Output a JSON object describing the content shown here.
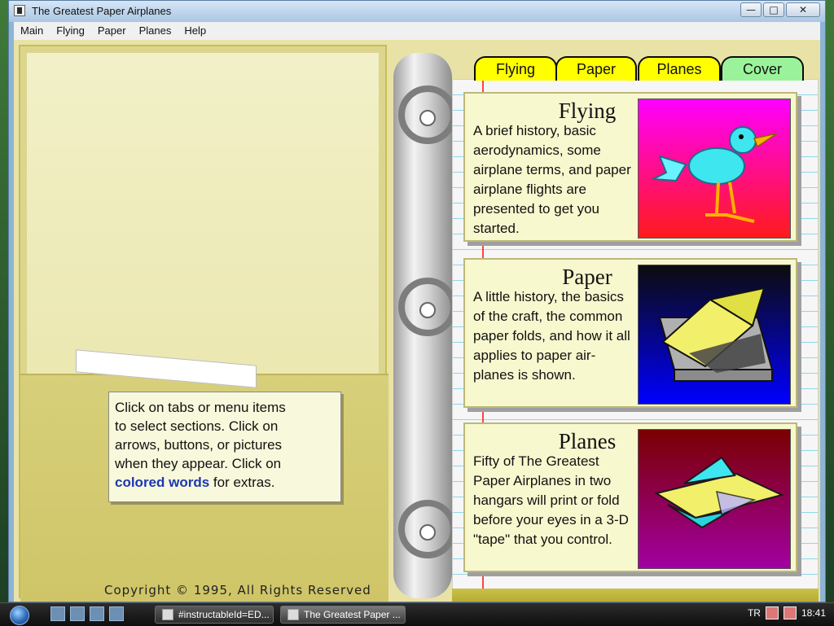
{
  "window": {
    "title": "The Greatest Paper Airplanes",
    "buttons": {
      "minimize": "—",
      "maximize": "□",
      "close": "✕"
    }
  },
  "menu": {
    "items": [
      "Main",
      "Flying",
      "Paper",
      "Planes",
      "Help"
    ]
  },
  "tabs": [
    "Flying",
    "Paper",
    "Planes",
    "Cover"
  ],
  "note": {
    "line1": "Click on tabs or menu items",
    "line2": "to select sections.  Click on",
    "line3": "arrows, buttons, or pictures",
    "line4": "when they appear. Click on",
    "colored": "colored words",
    "tail": " for extras."
  },
  "copyright": "Copyright © 1995, All Rights Reserved",
  "cards": [
    {
      "title": "Flying",
      "desc": "A brief history, basic aerodynamics, some airplane terms, and paper airplane flights are presented to get you started."
    },
    {
      "title": "Paper",
      "desc": "A little history, the basics of the craft, the common paper folds, and how it all applies to paper air-planes is shown."
    },
    {
      "title": "Planes",
      "desc": "Fifty of The Greatest Paper Airplanes in two hangars will print or fold before your eyes in a 3-D \"tape\" that you control."
    }
  ],
  "taskbar": {
    "start": "",
    "tasks": [
      "#instructableId=ED...",
      "The Greatest Paper ..."
    ],
    "lang": "TR",
    "clock": "18:41"
  },
  "icons": [
    "window-icon",
    "ie-icon",
    "desktop-icon",
    "explorer-icon",
    "paint-icon",
    "volume-icon",
    "network-icon"
  ],
  "colors": {
    "tab_yellow": "#ffff00",
    "tab_cover": "#9af39a",
    "colored_words": "#1c37b2"
  }
}
